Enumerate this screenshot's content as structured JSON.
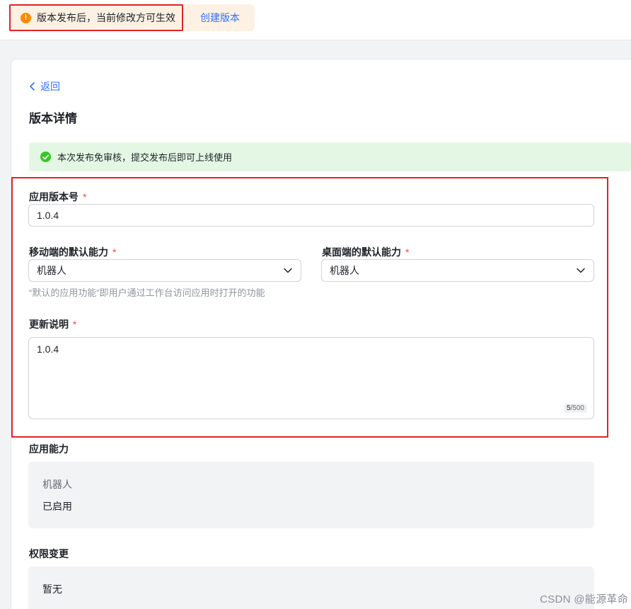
{
  "notice": {
    "text": "版本发布后，当前修改方可生效",
    "link": "创建版本"
  },
  "page": {
    "back_label": "返回",
    "title": "版本详情",
    "success_text": "本次发布免审核，提交发布后即可上线使用"
  },
  "form": {
    "version": {
      "label": "应用版本号",
      "required": "*",
      "value": "1.0.4"
    },
    "mobile_default": {
      "label": "移动端的默认能力",
      "required": "*",
      "value": "机器人"
    },
    "desktop_default": {
      "label": "桌面端的默认能力",
      "required": "*",
      "value": "机器人"
    },
    "default_hint": "“默认的应用功能”即用户通过工作台访问应用时打开的功能",
    "update_notes": {
      "label": "更新说明",
      "required": "*",
      "value": "1.0.4",
      "count": "5",
      "limit": "/500"
    }
  },
  "capabilities": {
    "label": "应用能力",
    "name": "机器人",
    "status": "已启用"
  },
  "permissions": {
    "label": "权限变更",
    "value": "暂无"
  },
  "watermark": "CSDN @能源革命",
  "colors": {
    "accent": "#3370ff",
    "warning": "#ff8800",
    "success": "#34c724",
    "highlight_border": "#e02424"
  }
}
